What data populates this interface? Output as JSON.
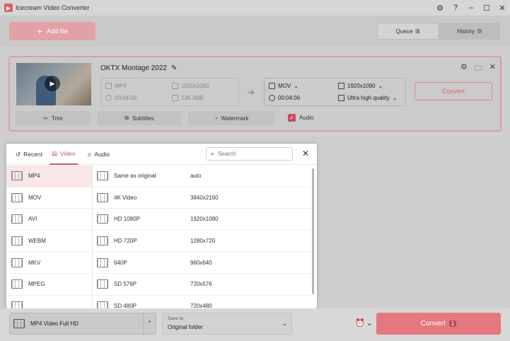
{
  "app": {
    "title": "Icecream Video Converter"
  },
  "header": {
    "add_file_label": "Add file",
    "tabs": [
      {
        "label": "Queue",
        "count": "1",
        "active": true
      },
      {
        "label": "History",
        "count": "0",
        "active": false
      }
    ]
  },
  "file": {
    "title": "OKTX Montage 2022",
    "source": {
      "format": "MP4",
      "resolution": "1920x1080",
      "duration": "00:04:06",
      "size": "238.3MB"
    },
    "target": {
      "format": "MOV",
      "resolution": "1920x1080",
      "duration": "00:04:06",
      "quality": "Ultra high quality"
    },
    "convert_label": "Convert",
    "buttons": {
      "trim": "Trim",
      "subtitles": "Subtitles",
      "watermark": "Watermark"
    },
    "audio_label": "Audio",
    "audio_checked": true
  },
  "popup": {
    "tabs": [
      {
        "label": "Recent",
        "icon": "history-icon"
      },
      {
        "label": "Video",
        "icon": "film-icon",
        "active": true
      },
      {
        "label": "Audio",
        "icon": "music-note-icon"
      }
    ],
    "search_placeholder": "Search",
    "formats": [
      "MP4",
      "MOV",
      "AVI",
      "WEBM",
      "MKV",
      "MPEG",
      ""
    ],
    "selected_format": "MP4",
    "resolutions": [
      {
        "name": "Same as original",
        "value": "auto"
      },
      {
        "name": "4K Video",
        "value": "3840x2160"
      },
      {
        "name": "HD 1080P",
        "value": "1920x1080"
      },
      {
        "name": "HD 720P",
        "value": "1280x720"
      },
      {
        "name": "640P",
        "value": "960x640"
      },
      {
        "name": "SD 576P",
        "value": "720x576"
      },
      {
        "name": "SD 480P",
        "value": "720x480"
      }
    ]
  },
  "bottom": {
    "preset_label": "MP4 Video Full HD",
    "save_to_label": "Save to:",
    "save_to_value": "Original folder",
    "convert_label": "Convert",
    "convert_count": "1"
  },
  "colors": {
    "accent": "#e5777f",
    "accent_dark": "#c85a66",
    "selected_bg": "#fbe6e8"
  }
}
